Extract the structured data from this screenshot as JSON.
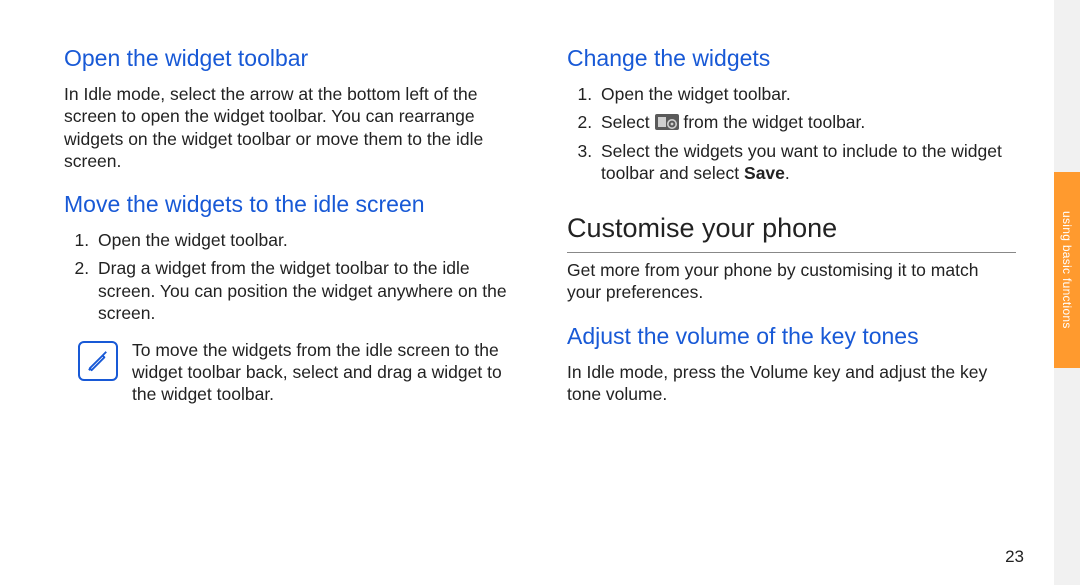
{
  "side_tab": {
    "label": "using basic functions"
  },
  "page_number": "23",
  "left": {
    "h_open": "Open the widget toolbar",
    "p_open": "In Idle mode, select the arrow at the bottom left of the screen to open the widget toolbar. You can rearrange widgets on the widget toolbar or move them to the idle screen.",
    "h_move": "Move the widgets to the idle screen",
    "steps_move": [
      "Open the widget toolbar.",
      "Drag a widget from the widget toolbar to the idle screen. You can position the widget anywhere on the screen."
    ],
    "note": "To move the widgets from the idle screen to the widget toolbar back, select and drag a widget to the widget toolbar."
  },
  "right": {
    "h_change": "Change the widgets",
    "steps_change": {
      "s1": "Open the widget toolbar.",
      "s2a": "Select ",
      "s2b": " from the widget toolbar.",
      "s3a": "Select the widgets you want to include to the widget toolbar and select ",
      "s3_bold": "Save",
      "s3b": "."
    },
    "h_customise": "Customise your phone",
    "p_customise": "Get more from your phone by customising it to match your preferences.",
    "h_volume": "Adjust the volume of the key tones",
    "p_volume": "In Idle mode, press the Volume key and adjust the key tone volume."
  }
}
